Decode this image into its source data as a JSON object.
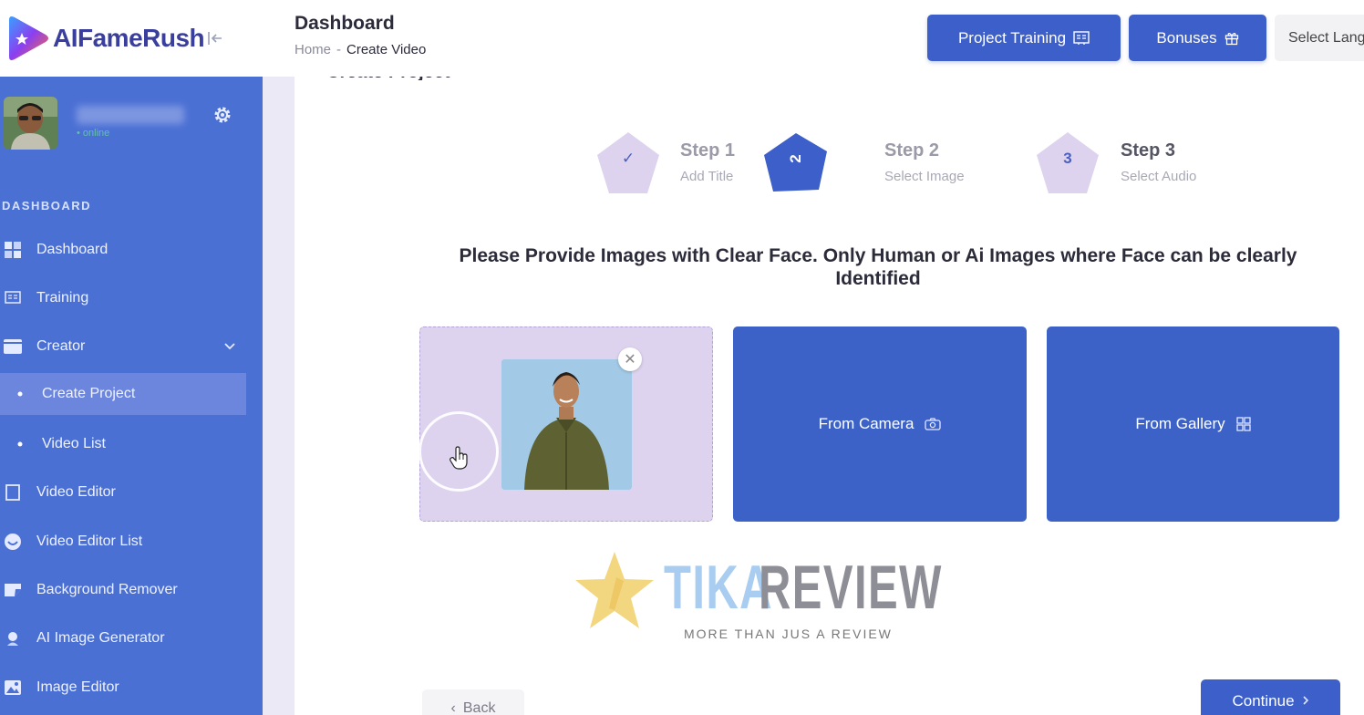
{
  "brand": {
    "name": "AIFameRush"
  },
  "header": {
    "title": "Dashboard",
    "breadcrumb": {
      "home": "Home",
      "separator": "-",
      "current": "Create Video"
    },
    "buttons": {
      "training": "Project Training",
      "bonuses": "Bonuses"
    },
    "language": "Select Lang"
  },
  "sidebar": {
    "user": {
      "status": "• online"
    },
    "section_label": "DASHBOARD",
    "items": [
      {
        "label": "Dashboard",
        "icon": "grid-icon"
      },
      {
        "label": "Training",
        "icon": "training-icon"
      },
      {
        "label": "Creator",
        "icon": "creator-icon",
        "expanded": true
      },
      {
        "label": "Create Project",
        "icon": "dot-icon",
        "active": true
      },
      {
        "label": "Video List",
        "icon": "dot-icon"
      },
      {
        "label": "Video Editor",
        "icon": "video-editor-icon"
      },
      {
        "label": "Video Editor List",
        "icon": "smile-icon"
      },
      {
        "label": "Background Remover",
        "icon": "bg-remover-icon"
      },
      {
        "label": "AI Image Generator",
        "icon": "ai-image-icon"
      },
      {
        "label": "Image Editor",
        "icon": "image-editor-icon"
      }
    ]
  },
  "main": {
    "card_title": "Create Project",
    "steps": [
      {
        "marker": "✓",
        "title": "Step 1",
        "subtitle": "Add Title",
        "state": "done"
      },
      {
        "marker": "2",
        "title": "Step 2",
        "subtitle": "Select Image",
        "state": "current"
      },
      {
        "marker": "3",
        "title": "Step 3",
        "subtitle": "Select Audio",
        "state": "pending"
      }
    ],
    "instruction": "Please Provide Images with Clear Face. Only Human or Ai Images where Face can be clearly Identified",
    "options": {
      "camera": "From Camera",
      "gallery": "From Gallery"
    },
    "remove_symbol": "✕",
    "back": "Back",
    "continue": "Continue"
  },
  "watermark": {
    "word1": "TIKA",
    "word2": "REVIEW",
    "tagline": "MORE THAN JUS A REVIEW"
  },
  "colors": {
    "primary": "#3c5fc9",
    "sidebar": "#4b70d4",
    "upload_tile": "#ddd3ee",
    "step_light": "#ddd3ee"
  }
}
